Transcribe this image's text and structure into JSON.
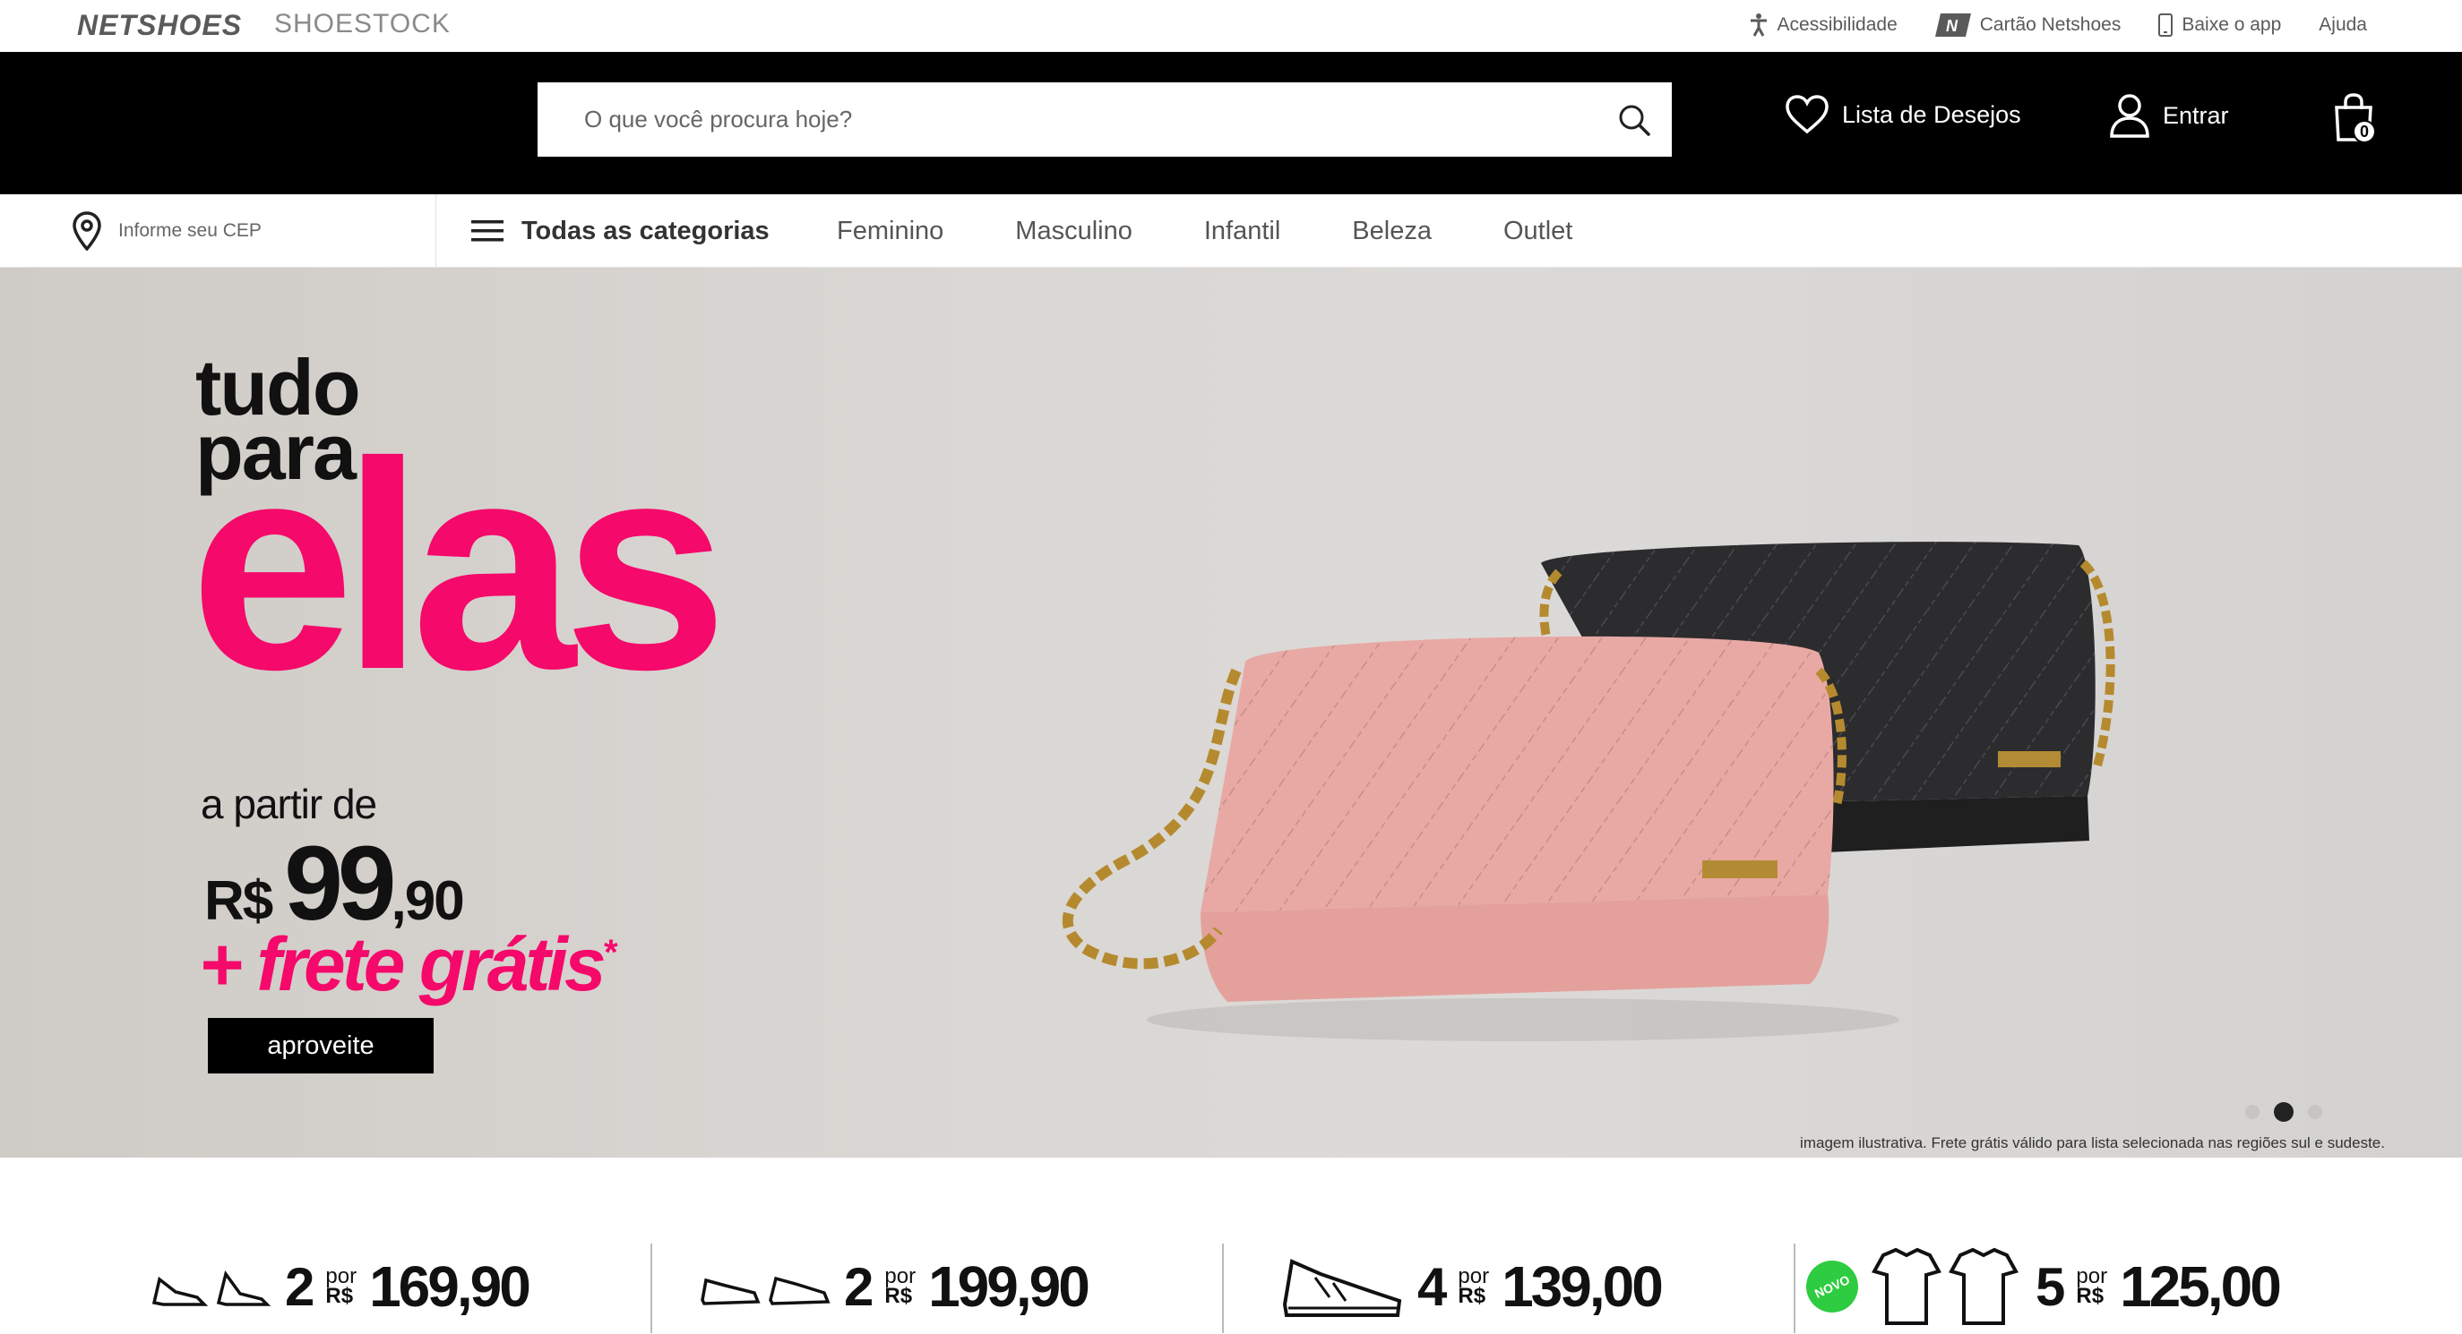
{
  "topbar": {
    "brand_primary": "NETSHOES",
    "brand_secondary": "SHOESTOCK",
    "links": [
      {
        "label": "Acessibilidade",
        "icon": "accessibility-icon"
      },
      {
        "label": "Cartão Netshoes",
        "icon": "card-icon"
      },
      {
        "label": "Baixe o app",
        "icon": "phone-icon"
      },
      {
        "label": "Ajuda",
        "icon": ""
      }
    ]
  },
  "header": {
    "search_placeholder": "O que você procura hoje?",
    "wishlist_label": "Lista de Desejos",
    "login_label": "Entrar",
    "cart_count": "0"
  },
  "nav": {
    "cep_label": "Informe seu CEP",
    "all_categories": "Todas as categorias",
    "links": [
      "Feminino",
      "Masculino",
      "Infantil",
      "Beleza",
      "Outlet"
    ]
  },
  "hero": {
    "line1": "tudo",
    "line2": "para",
    "headline": "elas",
    "from_label": "a partir de",
    "currency": "R$",
    "price_int": "99",
    "price_dec": ",90",
    "shipping": "+ frete grátis",
    "asterisk": "*",
    "cta": "aproveite",
    "disclaimer": "imagem ilustrativa. Frete grátis válido para lista selecionada nas regiões sul e sudeste.",
    "slides": 3,
    "active_slide": 2
  },
  "promos": [
    {
      "qty": "2",
      "por": "por",
      "cur": "R$",
      "price": "169,90"
    },
    {
      "qty": "2",
      "por": "por",
      "cur": "R$",
      "price": "199,90"
    },
    {
      "qty": "4",
      "por": "por",
      "cur": "R$",
      "price": "139,00"
    },
    {
      "badge": "NOVO",
      "qty": "5",
      "por": "por",
      "cur": "R$",
      "price": "125,00"
    }
  ],
  "colors": {
    "accent": "#f5096a",
    "header_bg": "#000000",
    "badge_green": "#2ecc40"
  }
}
